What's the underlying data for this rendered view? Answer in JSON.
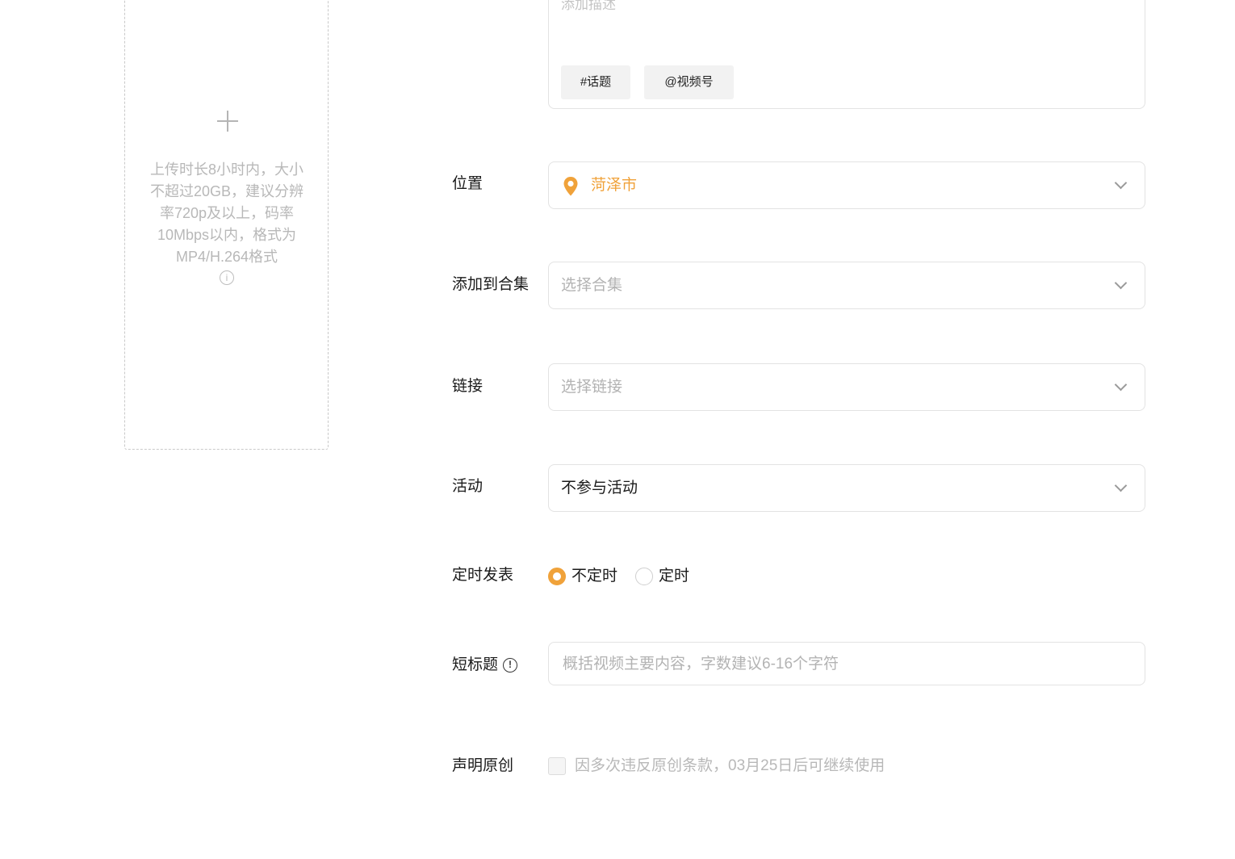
{
  "upload": {
    "hint": "上传时长8小时内，大小不超过20GB，建议分辨率720p及以上，码率10Mbps以内，格式为MP4/H.264格式",
    "info_icon": "info-icon"
  },
  "description": {
    "placeholder": "添加描述",
    "tags": [
      "#话题",
      "@视频号"
    ]
  },
  "location": {
    "label": "位置",
    "value": "菏泽市",
    "icon": "location-pin-icon",
    "accent_color": "#f0a23a"
  },
  "collection": {
    "label": "添加到合集",
    "placeholder": "选择合集"
  },
  "link": {
    "label": "链接",
    "placeholder": "选择链接"
  },
  "activity": {
    "label": "活动",
    "value": "不参与活动"
  },
  "schedule": {
    "label": "定时发表",
    "options": [
      "不定时",
      "定时"
    ],
    "selected": "不定时"
  },
  "short_title": {
    "label": "短标题",
    "placeholder": "概括视频主要内容，字数建议6-16个字符"
  },
  "original": {
    "label": "声明原创",
    "notice": "因多次违反原创条款，03月25日后可继续使用",
    "checked": false
  }
}
